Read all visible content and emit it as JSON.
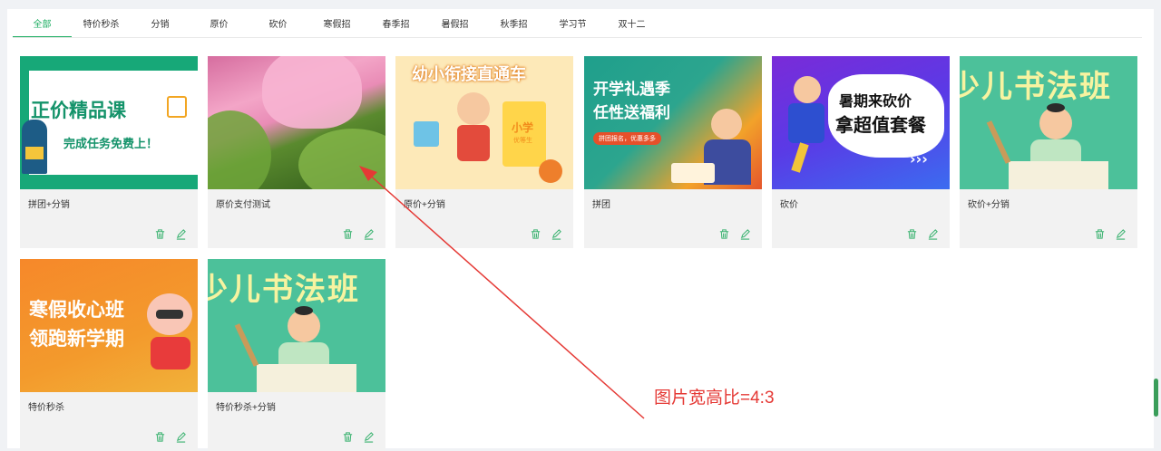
{
  "tabs": [
    {
      "label": "全部",
      "active": true
    },
    {
      "label": "特价秒杀"
    },
    {
      "label": "分销"
    },
    {
      "label": "原价"
    },
    {
      "label": "砍价"
    },
    {
      "label": "寒假招"
    },
    {
      "label": "春季招"
    },
    {
      "label": "暑假招"
    },
    {
      "label": "秋季招"
    },
    {
      "label": "学习节"
    },
    {
      "label": "双十二"
    }
  ],
  "cards": [
    {
      "title": "拼团+分销",
      "image": {
        "line1": "正价精品课",
        "line2": "完成任务免费上！"
      }
    },
    {
      "title": "原价支付测试",
      "image": {}
    },
    {
      "title": "原价+分销",
      "image": {
        "line1": "幼小衔接直通车",
        "line2": "小学",
        "line3": "优等生"
      }
    },
    {
      "title": "拼团",
      "image": {
        "line1": "开学礼遇季",
        "line2": "任性送福利",
        "line3": "拼团报名，优惠多多"
      }
    },
    {
      "title": "砍价",
      "image": {
        "line1": "暑期来砍价",
        "line2": "拿超值套餐"
      }
    },
    {
      "title": "砍价+分销",
      "image": {
        "line1": "少儿书法班"
      }
    },
    {
      "title": "特价秒杀",
      "image": {
        "line1": "寒假收心班",
        "line2": "领跑新学期"
      }
    },
    {
      "title": "特价秒杀+分销",
      "image": {
        "line1": "少儿书法班"
      }
    }
  ],
  "annotation": "图片宽高比=4:3",
  "icons": {
    "delete": "trash-icon",
    "edit": "edit-icon"
  },
  "colors": {
    "accent": "#1aad60",
    "annotation": "#e53935"
  }
}
